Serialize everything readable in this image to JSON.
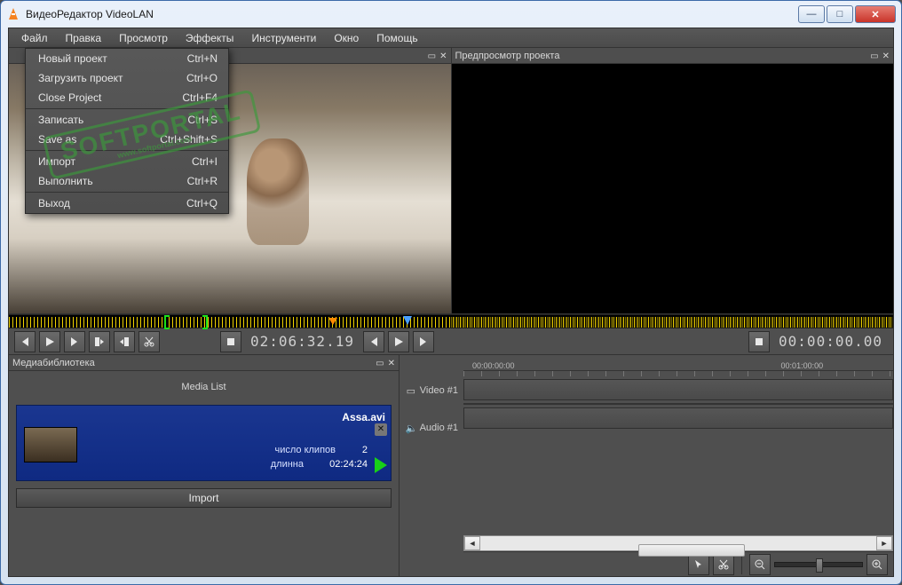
{
  "window": {
    "title": "ВидеоРедактор VideoLAN"
  },
  "menu": {
    "items": [
      "Файл",
      "Правка",
      "Просмотр",
      "Эффекты",
      "Инструменти",
      "Окно",
      "Помощь"
    ],
    "file_dropdown": [
      {
        "label": "Новый проект",
        "shortcut": "Ctrl+N"
      },
      {
        "label": "Загрузить проект",
        "shortcut": "Ctrl+O"
      },
      {
        "label": "Close Project",
        "shortcut": "Ctrl+F4"
      },
      {
        "sep": true
      },
      {
        "label": "Записать",
        "shortcut": "Ctrl+S"
      },
      {
        "label": "Save as",
        "shortcut": "Ctrl+Shift+S"
      },
      {
        "sep": true
      },
      {
        "label": "Импорт",
        "shortcut": "Ctrl+I"
      },
      {
        "label": "Выполнить",
        "shortcut": "Ctrl+R"
      },
      {
        "sep": true
      },
      {
        "label": "Выход",
        "shortcut": "Ctrl+Q"
      }
    ]
  },
  "watermark": {
    "text": "SOFTPORTAL",
    "sub": "www.softportal.com"
  },
  "panels": {
    "clip_preview": {
      "title": ""
    },
    "project_preview": {
      "title": "Предпросмотр проекта"
    }
  },
  "transport": {
    "left_tc": "02:06:32.19",
    "right_tc": "00:00:00.00"
  },
  "library": {
    "title": "Медиабиблиотека",
    "list_header": "Media List",
    "item": {
      "filename": "Assa.avi",
      "clips_label": "число клипов",
      "clips_value": "2",
      "length_label": "длинна",
      "length_value": "02:24:24"
    },
    "import_label": "Import"
  },
  "timeline": {
    "t0": "00:00:00:00",
    "t1": "00:01:00:00",
    "tracks": {
      "video": "Video #1",
      "audio": "Audio #1"
    }
  }
}
